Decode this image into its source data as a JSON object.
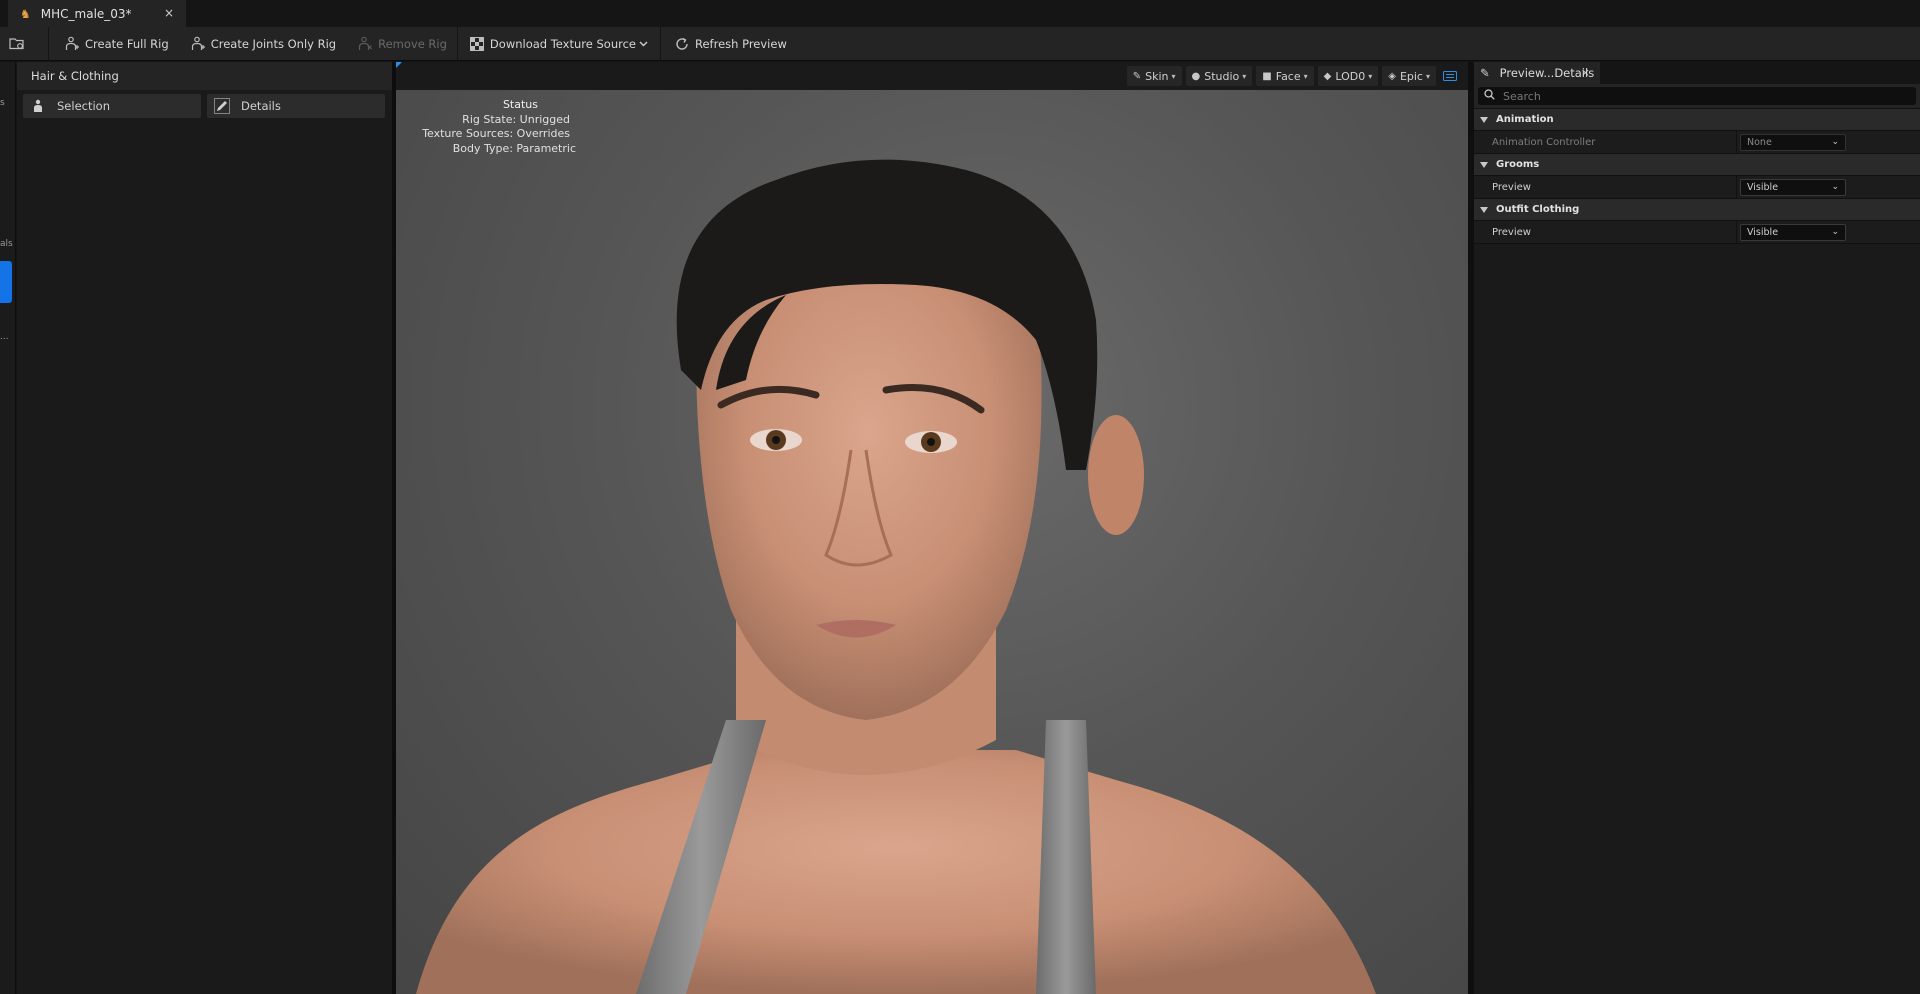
{
  "document_tab": {
    "title": "MHC_male_03*",
    "close": "×"
  },
  "toolbar": {
    "create_full_rig": "Create Full Rig",
    "create_joints_only_rig": "Create Joints Only Rig",
    "remove_rig": "Remove Rig",
    "download_texture_source": "Download Texture Source",
    "refresh_preview": "Refresh Preview"
  },
  "left_strip": {
    "frag1": "s",
    "frag2": "als",
    "frag3": "..."
  },
  "left_panel": {
    "title": "Hair & Clothing",
    "tabs": [
      {
        "label": "Selection"
      },
      {
        "label": "Details"
      }
    ]
  },
  "viewport": {
    "toolbar": [
      {
        "label": "Skin"
      },
      {
        "label": "Studio"
      },
      {
        "label": "Face"
      },
      {
        "label": "LOD0"
      },
      {
        "label": "Epic"
      }
    ],
    "status": {
      "title": "Status",
      "rig_state": "Rig State: Unrigged",
      "texture_sources": "Texture Sources: Overrides",
      "body_type": "Body Type: Parametric"
    }
  },
  "right_panel": {
    "tab_title": "Preview...Details",
    "close": "×",
    "search_placeholder": "Search",
    "sections": [
      {
        "title": "Animation",
        "props": [
          {
            "label": "Animation Controller",
            "value": "None"
          }
        ]
      },
      {
        "title": "Grooms",
        "props": [
          {
            "label": "Preview",
            "value": "Visible"
          }
        ]
      },
      {
        "title": "Outfit Clothing",
        "props": [
          {
            "label": "Preview",
            "value": "Visible"
          }
        ]
      }
    ]
  },
  "colors": {
    "accent_blue": "#1473e6",
    "tab_icon_orange": "#e8a33d",
    "viewport_bg": "#4f4f4f",
    "panel_bg": "#1a1a1a"
  }
}
